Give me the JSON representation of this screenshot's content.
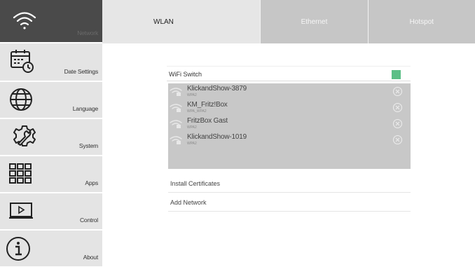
{
  "sidebar": {
    "items": [
      {
        "label": "Network",
        "icon": "wifi-icon",
        "active": true
      },
      {
        "label": "Date Settings",
        "icon": "calendar-clock-icon"
      },
      {
        "label": "Language",
        "icon": "globe-icon"
      },
      {
        "label": "System",
        "icon": "wrench-gear-icon"
      },
      {
        "label": "Apps",
        "icon": "apps-grid-icon"
      },
      {
        "label": "Control",
        "icon": "monitor-play-icon"
      },
      {
        "label": "About",
        "icon": "info-icon"
      }
    ]
  },
  "tabs": [
    {
      "label": "WLAN",
      "active": true
    },
    {
      "label": "Ethernet"
    },
    {
      "label": "Hotspot"
    }
  ],
  "wlan": {
    "switch_label": "WiFi Switch",
    "switch_on": true,
    "networks": [
      {
        "name": "KlickandShow-3879",
        "security": "WPA2"
      },
      {
        "name": "KM_Fritz!Box",
        "security": "WPA_WPA2"
      },
      {
        "name": "FritzBox Gast",
        "security": "WPA2"
      },
      {
        "name": "KlickandShow-1019",
        "security": "WPA2"
      }
    ],
    "install_certificates": "Install Certificates",
    "add_network": "Add Network"
  },
  "colors": {
    "sidebar_active": "#4a4a4a",
    "sidebar_bg": "#e4e4e4",
    "tab_active": "#e6e6e6",
    "tab_inactive": "#c6c6c6",
    "switch_on": "#5cbf87",
    "list_bg": "#c8c8c8"
  }
}
